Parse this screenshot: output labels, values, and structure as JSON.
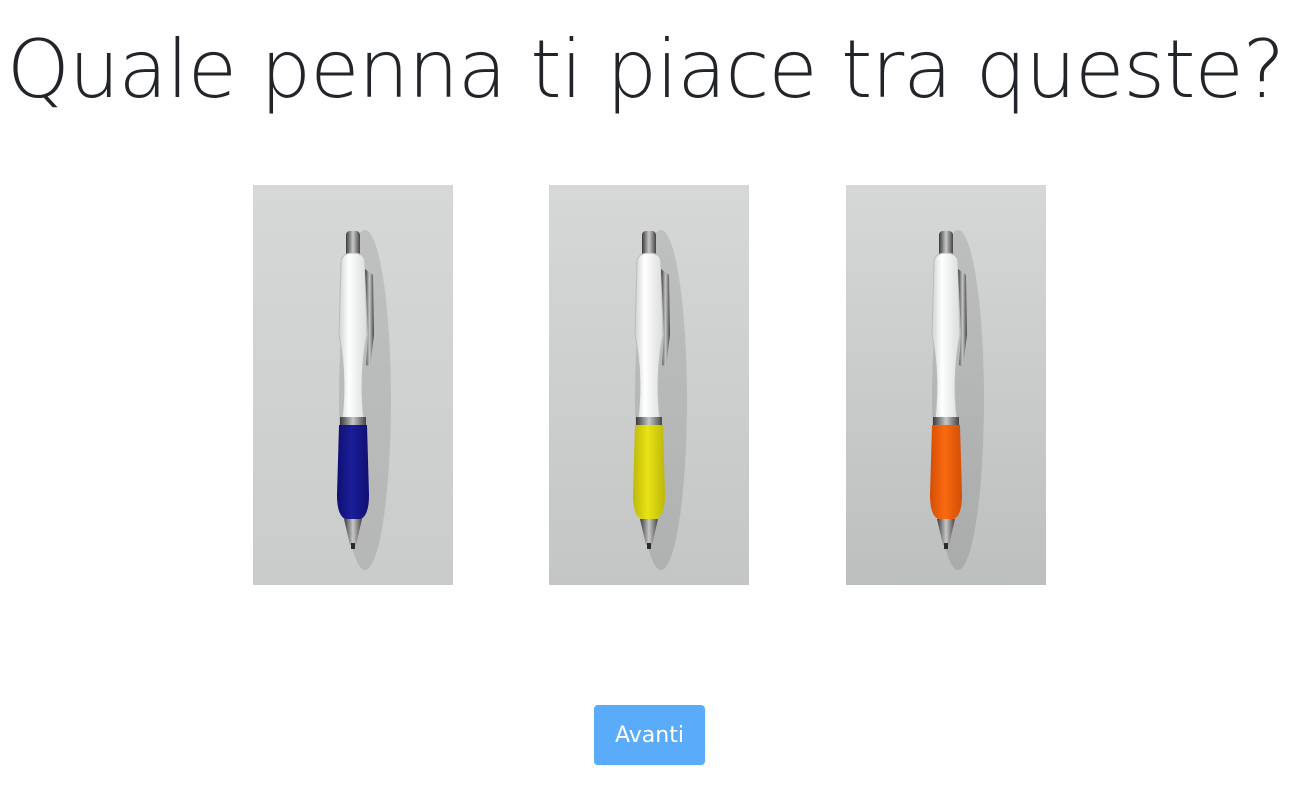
{
  "page": {
    "title": "Quale penna ti piace tra queste?"
  },
  "options": [
    {
      "name": "blue",
      "grip_color": "#1b1d9a",
      "grip_shade": "#0f1070",
      "background": "#c9cccb"
    },
    {
      "name": "yellow",
      "grip_color": "#e8e414",
      "grip_shade": "#bdb80a",
      "background": "#c3c6c5"
    },
    {
      "name": "orange",
      "grip_color": "#fb6a10",
      "grip_shade": "#d24e05",
      "background": "#bcbfbe"
    }
  ],
  "actions": {
    "next_label": "Avanti"
  },
  "colors": {
    "button": "#5aabf9",
    "text": "#212529"
  }
}
